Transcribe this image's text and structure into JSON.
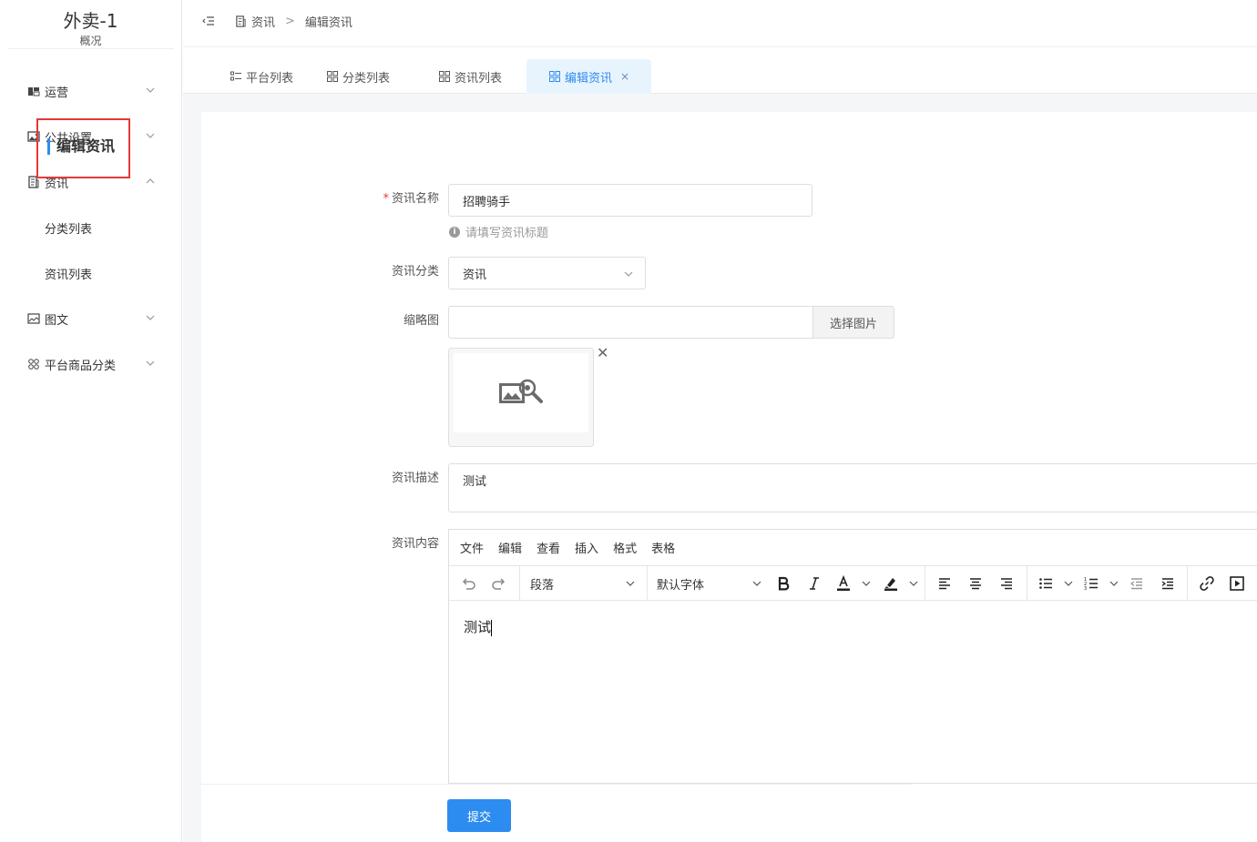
{
  "app": {
    "title": "外卖-1",
    "subtitle": "概况"
  },
  "sidebar": {
    "items": [
      {
        "label": "运营",
        "icon": "dashboard-icon"
      },
      {
        "label": "公共设置",
        "icon": "image-icon"
      },
      {
        "label": "资讯",
        "icon": "document-icon",
        "children": [
          "分类列表",
          "资讯列表"
        ]
      },
      {
        "label": "图文",
        "icon": "picture-icon"
      },
      {
        "label": "平台商品分类",
        "icon": "apps-icon"
      }
    ]
  },
  "breadcrumb": {
    "parent": "资讯",
    "separator": ">",
    "current": "编辑资讯"
  },
  "tabs": [
    {
      "label": "平台列表"
    },
    {
      "label": "分类列表"
    },
    {
      "label": "资讯列表"
    },
    {
      "label": "编辑资讯",
      "active": true,
      "close": "×"
    }
  ],
  "form": {
    "section_title": "编辑资讯",
    "name": {
      "label": "资讯名称",
      "required_mark": "*",
      "value": "招聘骑手",
      "hint": "请填写资讯标题"
    },
    "category": {
      "label": "资讯分类",
      "value": "资讯"
    },
    "thumbnail": {
      "label": "缩略图",
      "value": "",
      "button": "选择图片"
    },
    "description": {
      "label": "资讯描述",
      "value": "测试"
    },
    "content": {
      "label": "资讯内容",
      "menus": [
        "文件",
        "编辑",
        "查看",
        "插入",
        "格式",
        "表格"
      ],
      "block_format": "段落",
      "font_family": "默认字体",
      "body": "测试"
    },
    "submit": "提交"
  },
  "colors": {
    "primary": "#2d8cf0",
    "highlight_border": "#e53935"
  }
}
